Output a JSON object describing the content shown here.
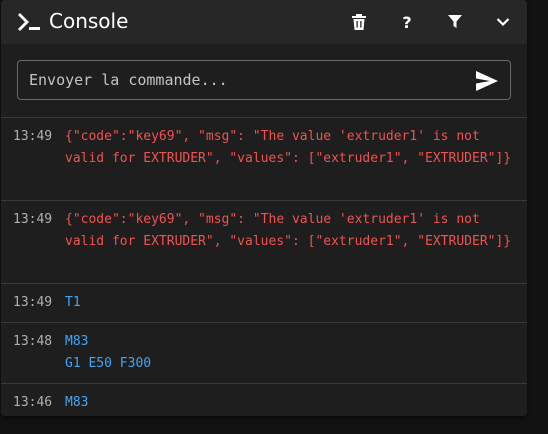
{
  "header": {
    "title": "Console",
    "icons": {
      "console": "console-prompt-icon",
      "trash": "trash-icon",
      "help": "help-icon",
      "filter": "filter-icon",
      "collapse": "chevron-down-icon"
    },
    "help_glyph": "?"
  },
  "command": {
    "placeholder": "Envoyer la commande...",
    "value": "",
    "send_icon": "send-icon"
  },
  "colors": {
    "error": "#ef5350",
    "command": "#42a5f5",
    "timestamp": "#b0b0b0"
  },
  "log": [
    {
      "time": "13:49",
      "kind": "error",
      "lines": [
        "{\"code\":\"key69\", \"msg\": \"The value 'extruder1' is not valid for EXTRUDER\", \"values\": [\"extruder1\", \"EXTRUDER\"]}"
      ]
    },
    {
      "time": "13:49",
      "kind": "error",
      "lines": [
        "{\"code\":\"key69\", \"msg\": \"The value 'extruder1' is not valid for EXTRUDER\", \"values\": [\"extruder1\", \"EXTRUDER\"]}"
      ]
    },
    {
      "time": "13:49",
      "kind": "cmd",
      "lines": [
        "T1"
      ]
    },
    {
      "time": "13:48",
      "kind": "cmd",
      "lines": [
        "M83",
        "G1 E50 F300"
      ]
    },
    {
      "time": "13:46",
      "kind": "cmd",
      "lines": [
        "M83"
      ]
    }
  ]
}
